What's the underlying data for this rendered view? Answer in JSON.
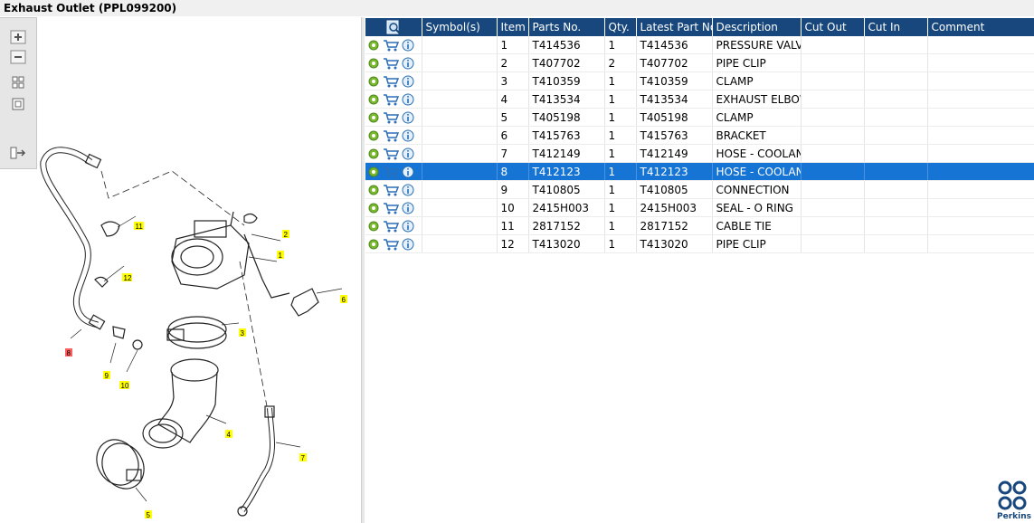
{
  "window": {
    "title": "Exhaust Outlet (PPL099200)"
  },
  "toolbar": {
    "buttons": [
      {
        "name": "zoom-in-button",
        "icon": "plus-icon"
      },
      {
        "name": "zoom-out-button",
        "icon": "minus-icon"
      },
      {
        "name": "fit-view-button",
        "icon": "grid-icon"
      },
      {
        "name": "actual-size-button",
        "icon": "square-icon"
      },
      {
        "name": "collapse-pane-button",
        "icon": "panel-arrow-icon"
      }
    ]
  },
  "diagram": {
    "callouts": [
      "1",
      "2",
      "3",
      "4",
      "5",
      "6",
      "7",
      "8",
      "9",
      "10",
      "11",
      "12"
    ],
    "highlighted_callout": "8",
    "colors": {
      "callout": "#ffff00",
      "highlight": "#ff6060"
    }
  },
  "table": {
    "columns": [
      "",
      "Symbol(s)",
      "Item",
      "Parts No.",
      "Qty.",
      "Latest Part No.",
      "Description",
      "Cut Out",
      "Cut In",
      "Comment"
    ],
    "rows": [
      {
        "item": "1",
        "part": "T414536",
        "qty": "1",
        "latest": "T414536",
        "desc": "PRESSURE VALVE"
      },
      {
        "item": "2",
        "part": "T407702",
        "qty": "2",
        "latest": "T407702",
        "desc": "PIPE CLIP"
      },
      {
        "item": "3",
        "part": "T410359",
        "qty": "1",
        "latest": "T410359",
        "desc": "CLAMP"
      },
      {
        "item": "4",
        "part": "T413534",
        "qty": "1",
        "latest": "T413534",
        "desc": "EXHAUST ELBOW"
      },
      {
        "item": "5",
        "part": "T405198",
        "qty": "1",
        "latest": "T405198",
        "desc": "CLAMP"
      },
      {
        "item": "6",
        "part": "T415763",
        "qty": "1",
        "latest": "T415763",
        "desc": "BRACKET"
      },
      {
        "item": "7",
        "part": "T412149",
        "qty": "1",
        "latest": "T412149",
        "desc": "HOSE - COOLANT"
      },
      {
        "item": "8",
        "part": "T412123",
        "qty": "1",
        "latest": "T412123",
        "desc": "HOSE - COOLANT"
      },
      {
        "item": "9",
        "part": "T410805",
        "qty": "1",
        "latest": "T410805",
        "desc": "CONNECTION"
      },
      {
        "item": "10",
        "part": "2415H003",
        "qty": "1",
        "latest": "2415H003",
        "desc": "SEAL - O RING"
      },
      {
        "item": "11",
        "part": "2817152",
        "qty": "1",
        "latest": "2817152",
        "desc": "CABLE TIE"
      },
      {
        "item": "12",
        "part": "T413020",
        "qty": "1",
        "latest": "T413020",
        "desc": "PIPE CLIP"
      }
    ],
    "selected_item": "8",
    "row_icons": [
      "gear-icon",
      "cart-icon",
      "info-icon"
    ],
    "colors": {
      "header": "#17477c",
      "selected": "#1574d4"
    }
  },
  "brand": {
    "name": "Perkins",
    "color": "#17477c"
  }
}
